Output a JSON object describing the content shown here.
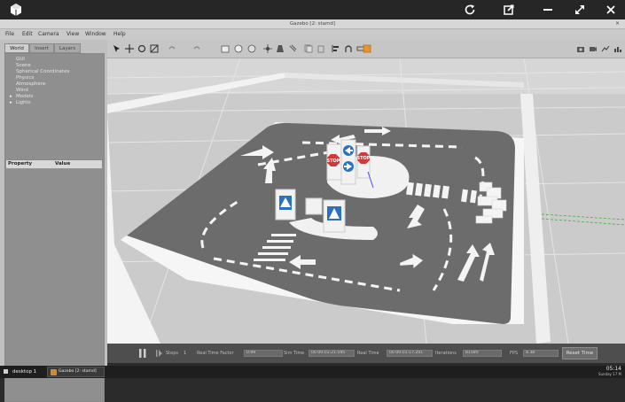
{
  "topbar": {
    "icons": {
      "logo": "cube-icon",
      "refresh": "refresh-icon",
      "open": "open-in-new-icon",
      "minimize": "minimize-icon",
      "fullscreen": "expand-icon",
      "close": "close-icon"
    }
  },
  "window": {
    "title": "Gazebo [2: stamd]"
  },
  "menu": {
    "file": "File",
    "edit": "Edit",
    "camera": "Camera",
    "view": "View",
    "window": "Window",
    "help": "Help"
  },
  "left_panel": {
    "tabs": [
      "World",
      "Insert",
      "Layers"
    ],
    "tree_items": [
      "GUI",
      "Scene",
      "Spherical Coordinates",
      "Physics",
      "Atmosphere",
      "Wind"
    ],
    "expandable_items": [
      {
        "arrow": "▸",
        "label": "Models"
      },
      {
        "arrow": "▸",
        "label": "Lights"
      }
    ],
    "property_header": "Property",
    "value_header": "Value"
  },
  "toolbar": {
    "tools": [
      "select-arrow-icon",
      "translate-icon",
      "rotate-icon",
      "scale-icon",
      "undo-icon",
      "redo-icon",
      "box-icon",
      "sphere-icon",
      "cylinder-icon",
      "point-light-icon",
      "spot-light-icon",
      "directional-light-icon",
      "copy-icon",
      "paste-icon",
      "align-icon",
      "snap-icon",
      "measure-icon",
      "orange-mode-icon"
    ],
    "right_tools": [
      "screenshot-icon",
      "record-icon",
      "plot-icon",
      "graph-icon"
    ]
  },
  "viewport": {
    "signs": {
      "stop_left": "STOP",
      "stop_right": "STOP"
    }
  },
  "bottombar": {
    "steps_label": "Steps",
    "steps_value": "1",
    "rtf_label": "Real Time Factor",
    "rtf_value": "0.99",
    "sim_time_label": "Sim Time",
    "sim_time_value": "00 00:01:21.595",
    "real_time_label": "Real Time",
    "real_time_value": "00 00:01:17.201",
    "iterations_label": "Iterations",
    "iterations_value": "81595",
    "fps_label": "FPS",
    "fps_value": "4.38",
    "reset_label": "Reset Time"
  },
  "taskbar": {
    "desktop_label": "desktop 1",
    "app_label": "Gazebo [2: stamd]",
    "time": "05:14",
    "date": "Sunday 17 M"
  }
}
